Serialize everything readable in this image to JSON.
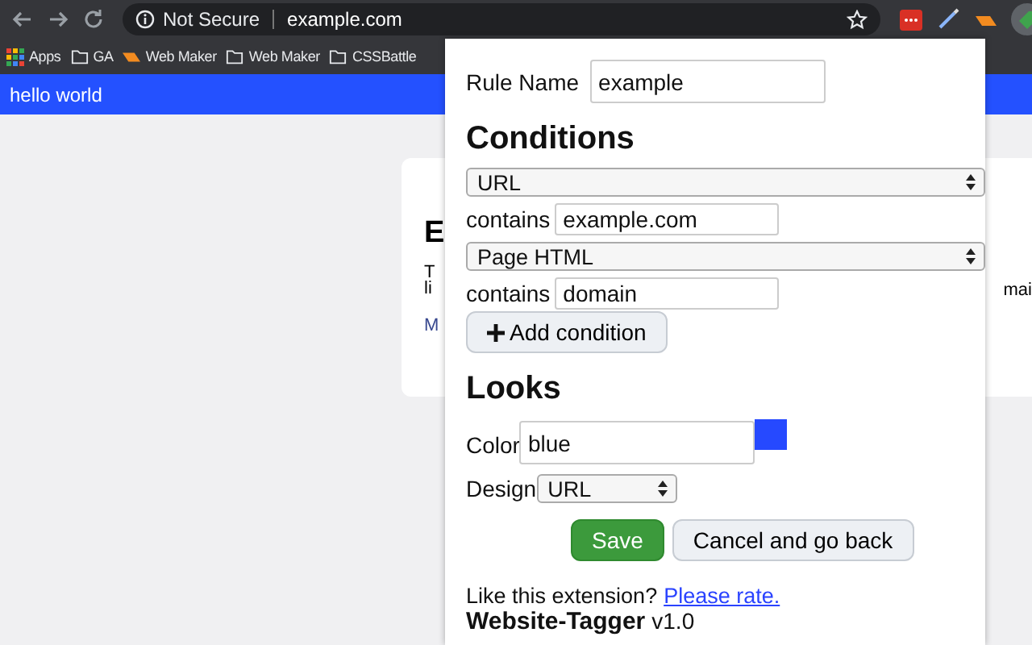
{
  "browser": {
    "security": "Not Secure",
    "url": "example.com",
    "bookmarks": [
      {
        "label": "Apps",
        "kind": "apps"
      },
      {
        "label": "GA",
        "kind": "folder"
      },
      {
        "label": "Web Maker",
        "kind": "webmaker"
      },
      {
        "label": "Web Maker",
        "kind": "folder"
      },
      {
        "label": "CSSBattle",
        "kind": "folder"
      }
    ]
  },
  "page": {
    "banner": "hello world",
    "card": {
      "heading": "E",
      "lines": [
        "T",
        "li"
      ],
      "link": "M",
      "right_text": "mai"
    }
  },
  "popup": {
    "rule_name": {
      "label": "Rule Name",
      "value": "example"
    },
    "conditions_heading": "Conditions",
    "conditions": [
      {
        "field": "URL",
        "operator": "contains",
        "value": "example.com"
      },
      {
        "field": "Page HTML",
        "operator": "contains",
        "value": "domain"
      }
    ],
    "add_button": "Add condition",
    "looks_heading": "Looks",
    "color": {
      "label": "Color",
      "value": "blue"
    },
    "design": {
      "label": "Design",
      "value": "URL"
    },
    "save_button": "Save",
    "cancel_button": "Cancel and go back",
    "footer": {
      "prompt": "Like this extension?",
      "link": "Please rate.",
      "name": "Website-Tagger",
      "version": "v1.0"
    }
  }
}
